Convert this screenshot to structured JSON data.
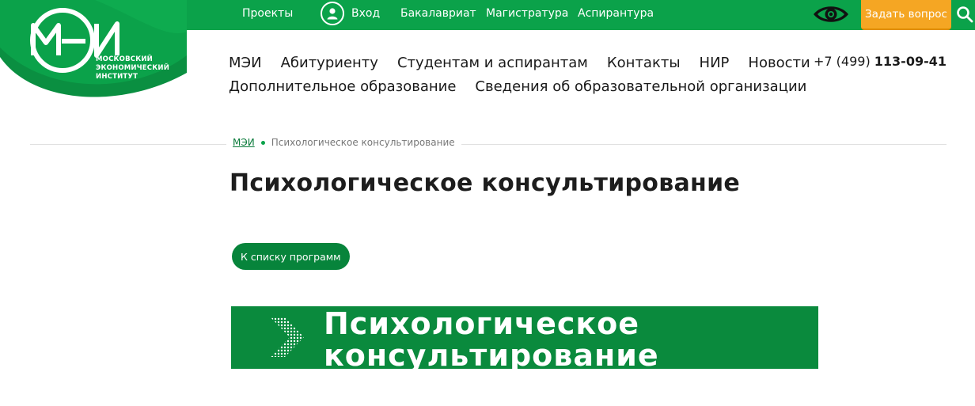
{
  "logo": {
    "mark": "МЭИ",
    "line1": "МОСКОВСКИЙ",
    "line2": "ЭКОНОМИЧЕСКИЙ",
    "line3": "ИНСТИТУТ"
  },
  "topbar": {
    "projects": "Проекты",
    "login": "Вход",
    "bachelor": "Бакалавриат",
    "master": "Магистратура",
    "postgrad": "Аспирантура",
    "eye_icon": "eye-icon",
    "ask": "Задать вопрос",
    "search_icon": "search-icon",
    "accent": "#0ba24a",
    "ask_color": "#f5a623"
  },
  "nav": {
    "row1": [
      "МЭИ",
      "Абитуриенту",
      "Студентам и аспирантам",
      "Контакты",
      "НИР",
      "Новости"
    ],
    "row2": [
      "Дополнительное образование",
      "Сведения об образовательной организации"
    ]
  },
  "phone": {
    "prefix": "+7 (499)",
    "number": "113-09-41"
  },
  "breadcrumb": {
    "home": "МЭИ",
    "current": "Психологическое консультирование"
  },
  "page": {
    "title": "Психологическое консультирование",
    "back_button": "К списку программ"
  },
  "banner": {
    "line1": "Психологическое",
    "line2": "консультирование",
    "color": "#0a8a3d"
  }
}
